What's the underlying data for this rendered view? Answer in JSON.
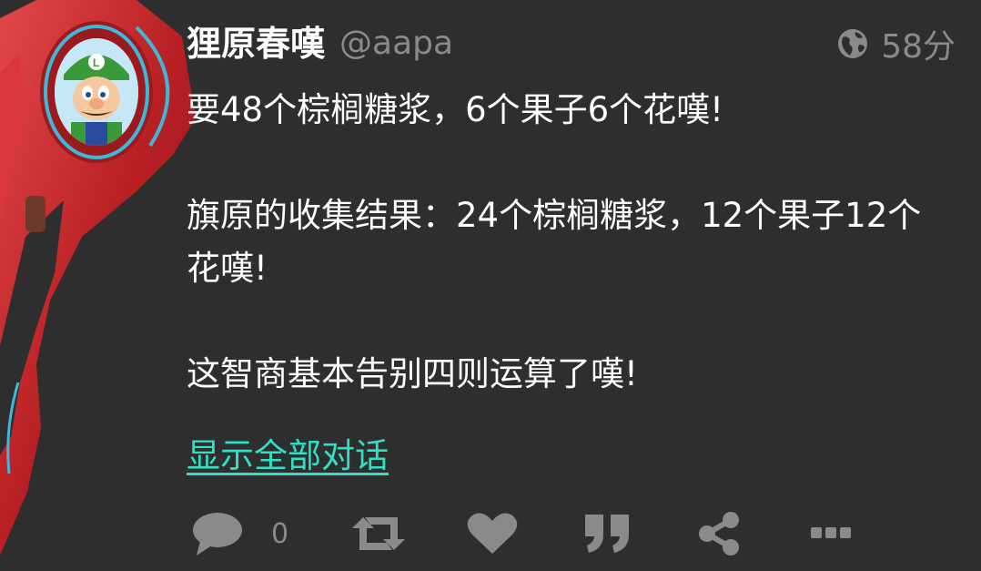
{
  "post": {
    "display_name": "狸原春嘆",
    "handle": "@aapa",
    "visibility_icon": "globe-icon",
    "time": "58分",
    "paragraphs": [
      "要48个棕榈糖浆，6个果子6个花嘆!",
      "旗原的收集结果：24个棕榈糖浆，12个果子12个花嘆!",
      "这智商基本告别四则运算了嘆!"
    ],
    "show_thread": "显示全部对话"
  },
  "actions": {
    "reply_icon": "reply-icon",
    "reply_count": "0",
    "boost_icon": "boost-icon",
    "favourite_icon": "heart-icon",
    "quote_icon": "quote-icon",
    "share_icon": "share-icon",
    "more_icon": "more-icon"
  },
  "colors": {
    "background": "#2e2e2e",
    "text": "#ffffff",
    "muted": "#8a8a8a",
    "link": "#2fe0c5",
    "frame": "#c8262a"
  }
}
